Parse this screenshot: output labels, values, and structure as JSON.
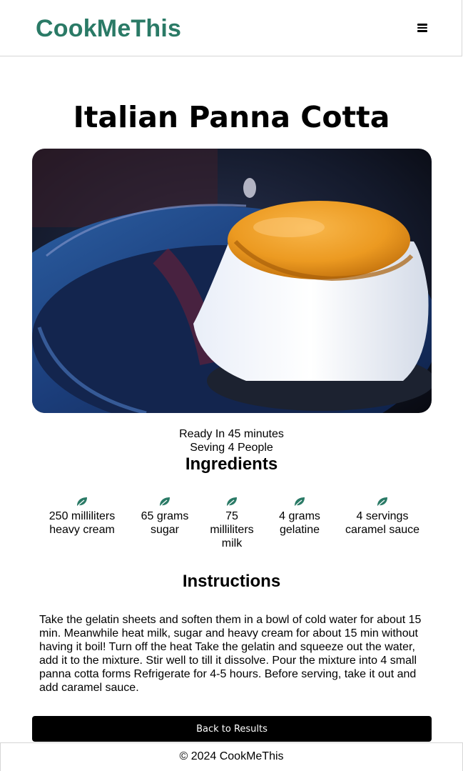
{
  "header": {
    "brand": "CookMeThis",
    "menu_icon": "hamburger-menu-icon"
  },
  "recipe": {
    "title": "Italian Panna Cotta",
    "image_alt": "Italian Panna Cotta",
    "ready_text": "Ready In 45 minutes",
    "serving_text": "Seving 4 People"
  },
  "ingredients": {
    "heading": "Ingredients",
    "icon": "leaf-icon",
    "items": [
      {
        "label": "250 milliliters heavy cream"
      },
      {
        "label": "65 grams sugar"
      },
      {
        "label": "75 milliliters milk"
      },
      {
        "label": "4 grams gelatine"
      },
      {
        "label": "4 servings caramel sauce"
      }
    ]
  },
  "instructions": {
    "heading": "Instructions",
    "text": "Take the gelatin sheets and soften them in a bowl of cold water for about 15 min. Meanwhile heat milk, sugar and heavy cream for about 15 min without having it boil! Turn off the heat Take the gelatin and squeeze out the water, add it to the mixture. Stir well to till it dissolve. Pour the mixture into 4 small panna cotta forms Refrigerate for 4-5 hours. Before serving, take it out and add caramel sauce."
  },
  "actions": {
    "back_label": "Back to Results"
  },
  "footer": {
    "text": "© 2024 CookMeThis"
  },
  "colors": {
    "brand": "#2a7a66",
    "leaf": "#2a7a66",
    "button_bg": "#000000"
  }
}
